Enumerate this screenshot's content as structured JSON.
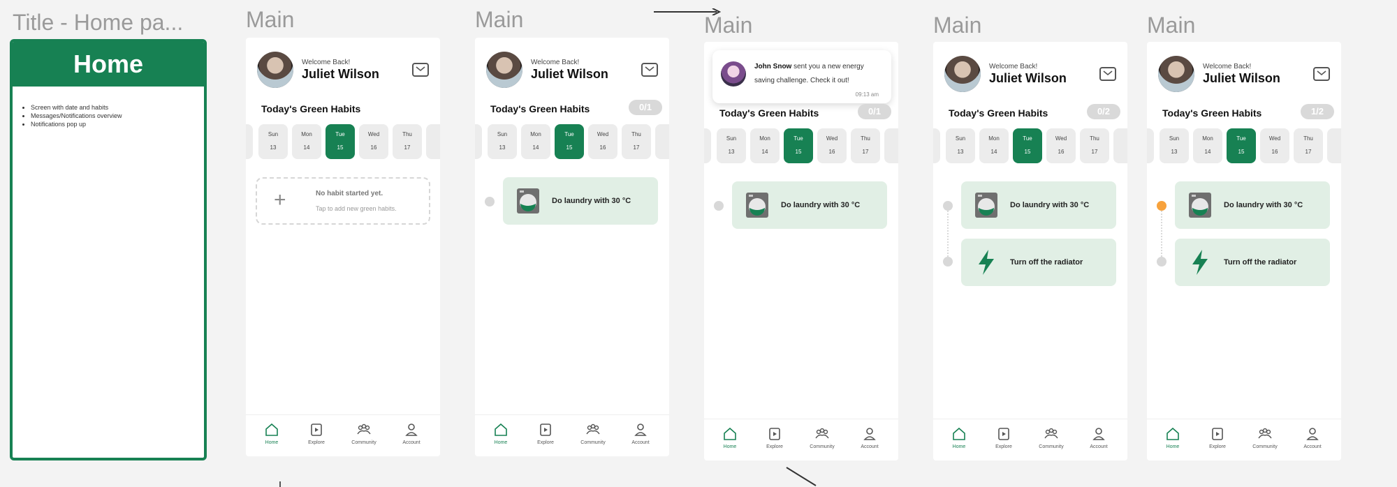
{
  "title_frame": {
    "label": "Title - Home pa...",
    "header": "Home",
    "bullets": [
      "Screen with date and habits",
      "Messages/Notifications overview",
      "Notifications pop up"
    ]
  },
  "screens": [
    {
      "label": "Main",
      "welcome": "Welcome Back!",
      "name": "Juliet Wilson",
      "habits_title": "Today's Green Habits",
      "counter": "",
      "empty_title": "No habit started yet.",
      "empty_sub": "Tap to add new green habits."
    },
    {
      "label": "Main",
      "welcome": "Welcome Back!",
      "name": "Juliet Wilson",
      "habits_title": "Today's Green Habits",
      "counter": "0/1",
      "habits": [
        "Do laundry with 30 °C"
      ]
    },
    {
      "label": "Main",
      "habits_title": "Today's Green Habits",
      "counter": "0/1",
      "notification": {
        "sender": "John Snow",
        "message": " sent you a new energy saving challenge. Check it out!",
        "time": "09:13 am"
      },
      "habits": [
        "Do laundry with 30 °C"
      ]
    },
    {
      "label": "Main",
      "welcome": "Welcome Back!",
      "name": "Juliet Wilson",
      "habits_title": "Today's Green Habits",
      "counter": "0/2",
      "habits": [
        "Do laundry with 30 °C",
        "Turn off the radiator"
      ]
    },
    {
      "label": "Main",
      "welcome": "Welcome Back!",
      "name": "Juliet Wilson",
      "habits_title": "Today's Green Habits",
      "counter": "1/2",
      "habits": [
        "Do laundry with 30 °C",
        "Turn off the radiator"
      ]
    }
  ],
  "days": [
    {
      "name": "Sun",
      "date": "13"
    },
    {
      "name": "Mon",
      "date": "14"
    },
    {
      "name": "Tue",
      "date": "15"
    },
    {
      "name": "Wed",
      "date": "16"
    },
    {
      "name": "Thu",
      "date": "17"
    }
  ],
  "tabs": [
    "Home",
    "Explore",
    "Community",
    "Account"
  ],
  "colors": {
    "brand_green": "#178153",
    "habit_bg": "#e1efe5",
    "done_dot": "#f7a23c",
    "canvas": "#f3f3f3"
  }
}
